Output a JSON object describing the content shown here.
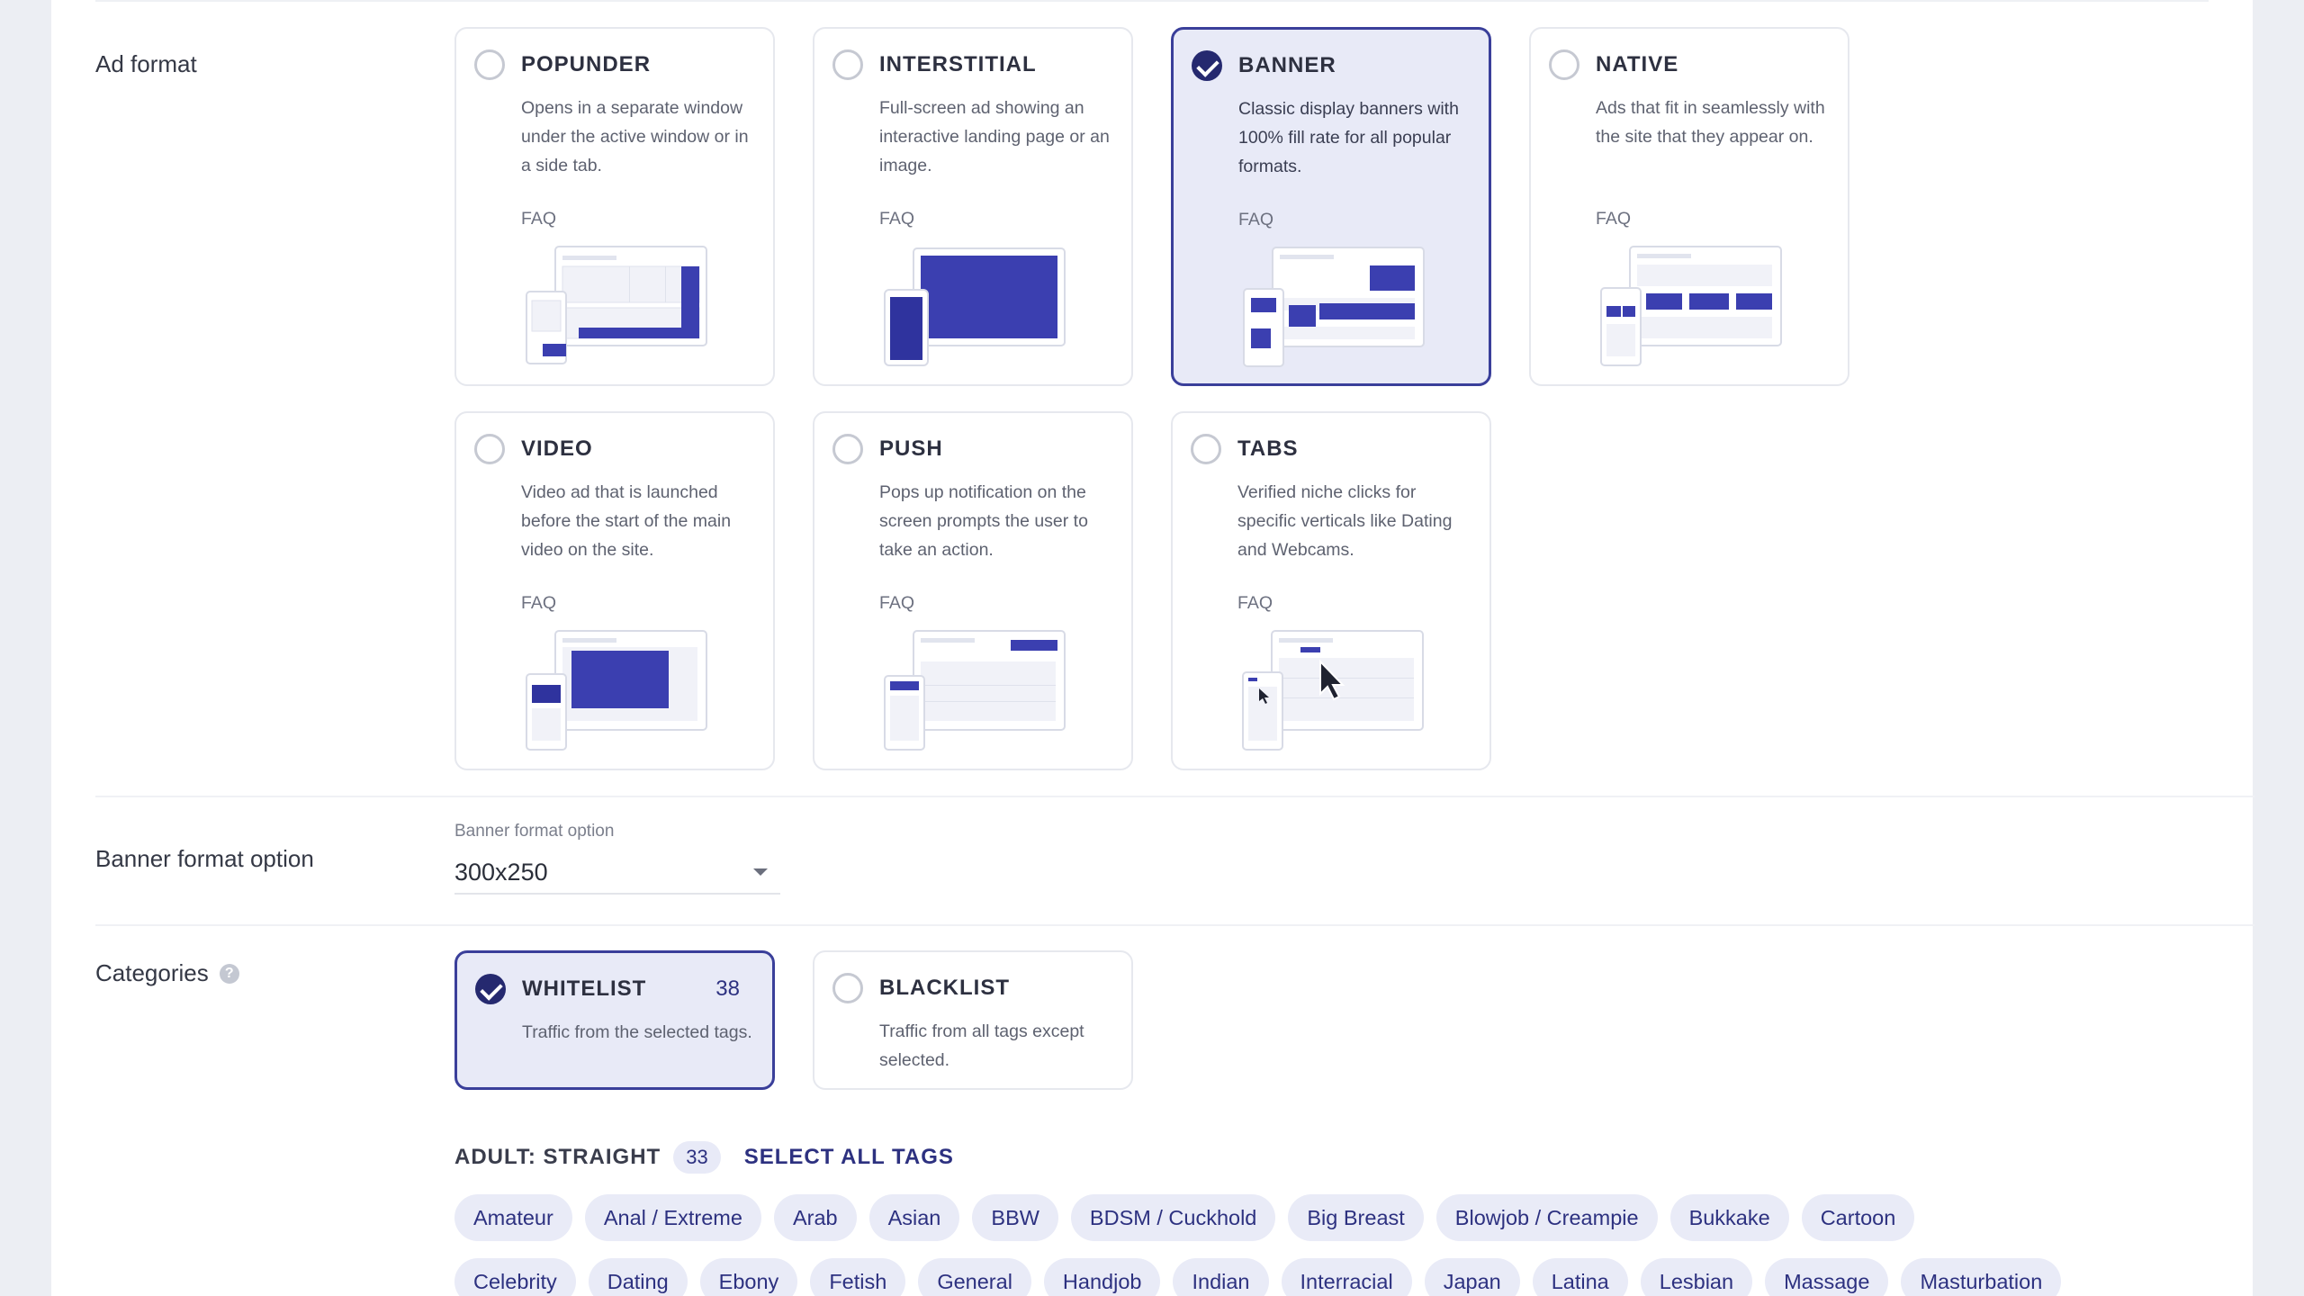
{
  "ad_format": {
    "label": "Ad format",
    "options": [
      {
        "id": "popunder",
        "title": "POPUNDER",
        "desc": "Opens in a separate window under the active window or in a side tab.",
        "faq": "FAQ",
        "selected": false
      },
      {
        "id": "interstitial",
        "title": "INTERSTITIAL",
        "desc": "Full-screen ad showing an interactive landing page or an image.",
        "faq": "FAQ",
        "selected": false
      },
      {
        "id": "banner",
        "title": "BANNER",
        "desc": "Classic display banners with 100% fill rate for all popular formats.",
        "faq": "FAQ",
        "selected": true
      },
      {
        "id": "native",
        "title": "NATIVE",
        "desc": "Ads that fit in seamlessly with the site that they appear on.",
        "faq": "FAQ",
        "selected": false
      },
      {
        "id": "video",
        "title": "VIDEO",
        "desc": "Video ad that is launched before the start of the main video on the site.",
        "faq": "FAQ",
        "selected": false
      },
      {
        "id": "push",
        "title": "PUSH",
        "desc": "Pops up notification on the screen prompts the user to take an action.",
        "faq": "FAQ",
        "selected": false
      },
      {
        "id": "tabs",
        "title": "TABS",
        "desc": "Verified niche clicks for specific verticals like Dating and Webcams.",
        "faq": "FAQ",
        "selected": false
      }
    ]
  },
  "banner_format": {
    "label": "Banner format option",
    "field_label": "Banner format option",
    "value": "300x250"
  },
  "categories": {
    "label": "Categories",
    "help_icon": "?",
    "whitelist": {
      "title": "WHITELIST",
      "count": "38",
      "desc": "Traffic from the selected tags.",
      "selected": true
    },
    "blacklist": {
      "title": "BLACKLIST",
      "desc": "Traffic from all tags except selected.",
      "selected": false
    }
  },
  "tags": {
    "group_label": "ADULT: STRAIGHT",
    "group_count": "33",
    "select_all": "SELECT ALL TAGS",
    "row1": [
      "Amateur",
      "Anal / Extreme",
      "Arab",
      "Asian",
      "BBW",
      "BDSM / Cuckhold",
      "Big Breast",
      "Blowjob / Creampie",
      "Bukkake",
      "Cartoon"
    ],
    "row2": [
      "Celebrity",
      "Dating",
      "Ebony",
      "Fetish",
      "General",
      "Handjob",
      "Indian",
      "Interracial",
      "Japan",
      "Latina",
      "Lesbian",
      "Massage",
      "Masturbation"
    ]
  },
  "colors": {
    "accent": "#25296f",
    "selected_bg": "#e8eaf7",
    "illustration_blue": "#3b3fb0"
  }
}
